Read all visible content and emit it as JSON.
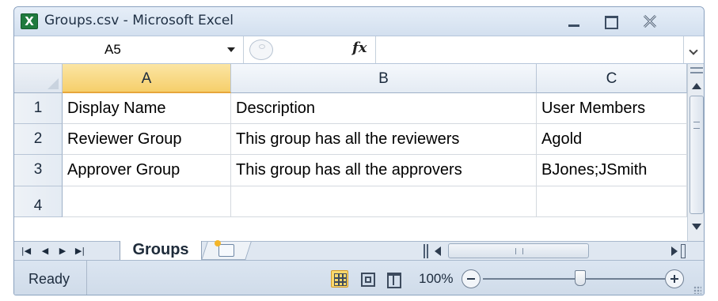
{
  "window": {
    "title": "Groups.csv - Microsoft Excel",
    "app_icon_letter": "X"
  },
  "formula_bar": {
    "name_box": "A5",
    "fx": "fx",
    "formula": ""
  },
  "grid": {
    "columns": [
      "A",
      "B",
      "C"
    ],
    "active_column": "A",
    "rows": [
      {
        "num": "1",
        "cells": [
          "Display Name",
          "Description",
          "User Members"
        ]
      },
      {
        "num": "2",
        "cells": [
          "Reviewer Group",
          "This group has all the reviewers",
          "Agold"
        ]
      },
      {
        "num": "3",
        "cells": [
          "Approver Group",
          "This group has all the approvers",
          "BJones;JSmith"
        ]
      },
      {
        "num": "4",
        "cells": [
          "",
          "",
          ""
        ]
      }
    ]
  },
  "sheet_tabs": {
    "active": "Groups"
  },
  "status_bar": {
    "status": "Ready",
    "zoom": "100%",
    "zoom_level": 100
  },
  "colors": {
    "chrome": "#d9e4f1",
    "active_header": "#f6cf6b",
    "gridline": "#d4d9df"
  }
}
